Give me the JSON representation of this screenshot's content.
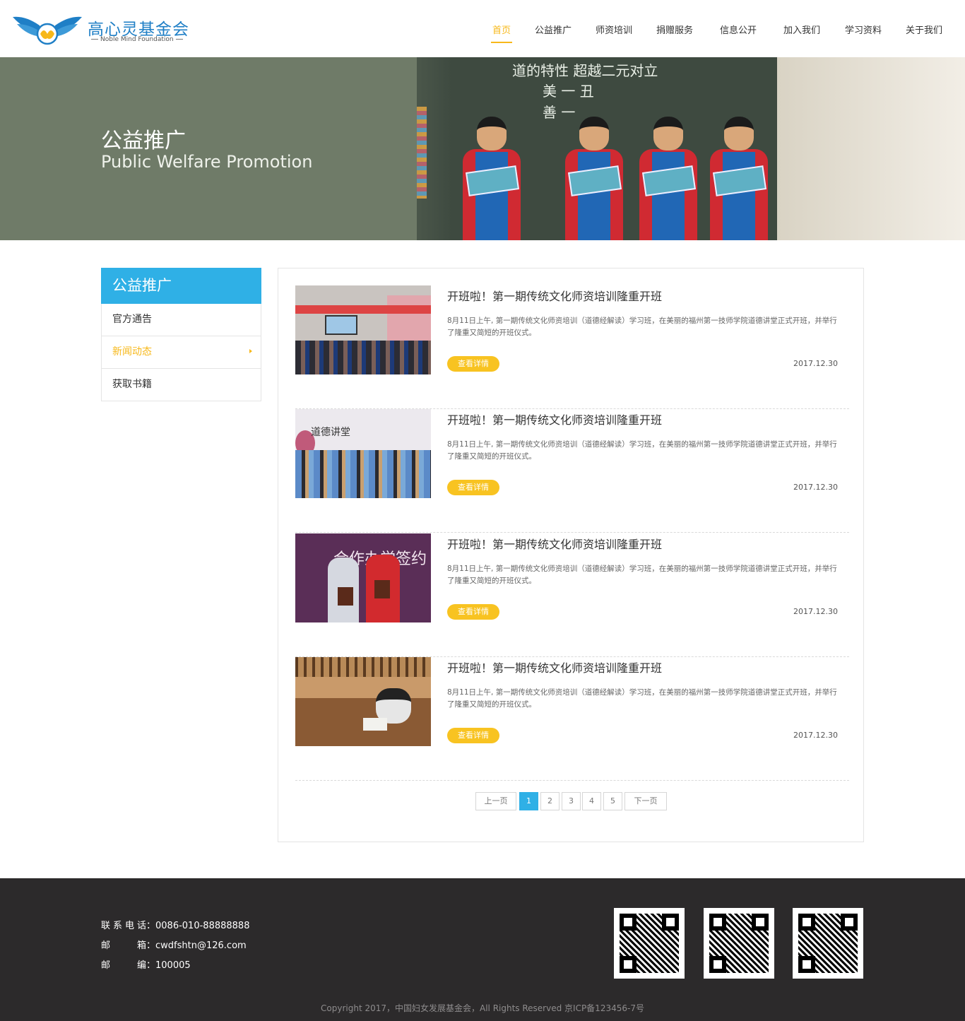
{
  "header": {
    "logo_cn": "高心灵基金会",
    "logo_en": "Noble Mind Foundation",
    "nav": [
      {
        "label": "首页",
        "active": true
      },
      {
        "label": "公益推广",
        "active": false
      },
      {
        "label": "师资培训",
        "active": false
      },
      {
        "label": "捐赠服务",
        "active": false
      },
      {
        "label": "信息公开",
        "active": false
      },
      {
        "label": "加入我们",
        "active": false
      },
      {
        "label": "学习资料",
        "active": false
      },
      {
        "label": "关于我们",
        "active": false
      }
    ]
  },
  "banner": {
    "title": "公益推广",
    "subtitle": "Public Welfare Promotion",
    "board_line1": "道的特性 超越二元对立",
    "board_line2": "美 一 丑",
    "board_line3": "善 一"
  },
  "sidebar": {
    "title": "公益推广",
    "items": [
      {
        "label": "官方通告",
        "active": false
      },
      {
        "label": "新闻动态",
        "active": true
      },
      {
        "label": "获取书籍",
        "active": false
      }
    ]
  },
  "articles": [
    {
      "title": "开班啦！第一期传统文化师资培训隆重开班",
      "desc": "8月11日上午, 第一期传统文化师资培训（道德经解读）学习班，在美丽的福州第一技师学院道德讲堂正式开班，并举行了隆重又简短的开班仪式。",
      "button": "查看详情",
      "date": "2017.12.30"
    },
    {
      "title": "开班啦！第一期传统文化师资培训隆重开班",
      "desc": "8月11日上午, 第一期传统文化师资培训（道德经解读）学习班，在美丽的福州第一技师学院道德讲堂正式开班，并举行了隆重又简短的开班仪式。",
      "button": "查看详情",
      "date": "2017.12.30"
    },
    {
      "title": "开班啦！第一期传统文化师资培训隆重开班",
      "desc": "8月11日上午, 第一期传统文化师资培训（道德经解读）学习班，在美丽的福州第一技师学院道德讲堂正式开班，并举行了隆重又简短的开班仪式。",
      "button": "查看详情",
      "date": "2017.12.30"
    },
    {
      "title": "开班啦！第一期传统文化师资培训隆重开班",
      "desc": "8月11日上午, 第一期传统文化师资培训（道德经解读）学习班，在美丽的福州第一技师学院道德讲堂正式开班，并举行了隆重又简短的开班仪式。",
      "button": "查看详情",
      "date": "2017.12.30"
    }
  ],
  "thumb_signs": {
    "t2": "道德讲堂",
    "t3": "合作办学签约"
  },
  "pagination": {
    "prev": "上一页",
    "pages": [
      "1",
      "2",
      "3",
      "4",
      "5"
    ],
    "current": "1",
    "next": "下一页"
  },
  "footer": {
    "phone_label": "联系电话",
    "phone": "0086-010-88888888",
    "email_label": "邮箱",
    "email": "cwdfshtn@126.com",
    "zip_label": "邮编",
    "zip": "100005",
    "copyright": "Copyright  2017，中国妇女发展基金会，All Rights Reserved 京ICP备123456-7号"
  },
  "colors": {
    "accent": "#f7b81a",
    "primary": "#2fb0e6",
    "footer_bg": "#2c2a2b"
  }
}
